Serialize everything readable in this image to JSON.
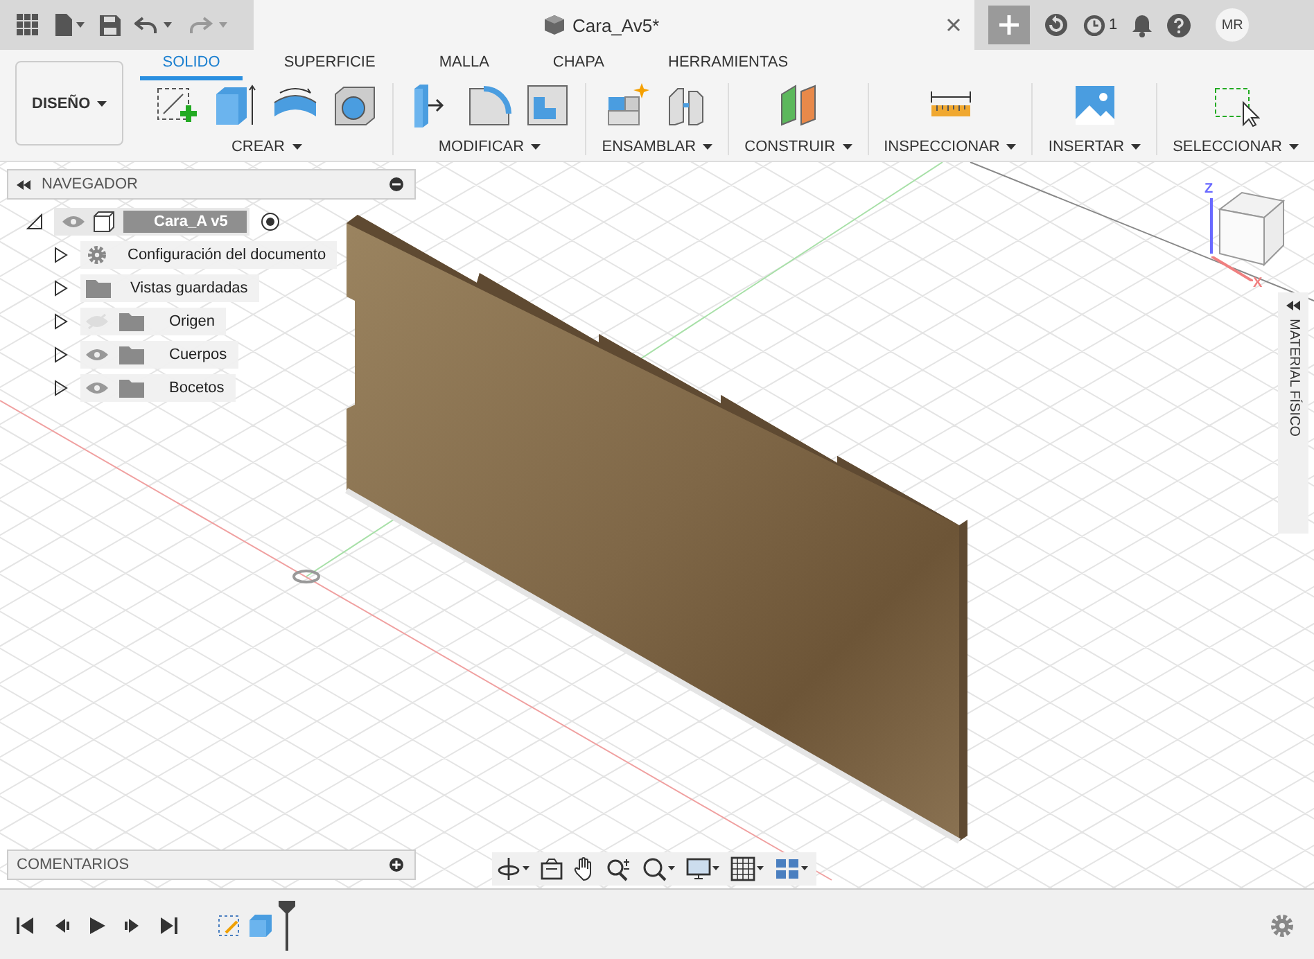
{
  "document_tab": {
    "title": "Cara_Av5*"
  },
  "jobs": {
    "count": "1"
  },
  "user": {
    "initials": "MR"
  },
  "workspace": {
    "label": "DISEÑO"
  },
  "toolbar_tabs": [
    {
      "label": "SOLIDO",
      "selected": true
    },
    {
      "label": "SUPERFICIE",
      "selected": false
    },
    {
      "label": "MALLA",
      "selected": false
    },
    {
      "label": "CHAPA",
      "selected": false
    },
    {
      "label": "HERRAMIENTAS",
      "selected": false
    }
  ],
  "tool_groups": [
    {
      "label": "CREAR",
      "kind": "create"
    },
    {
      "label": "MODIFICAR",
      "kind": "modify"
    },
    {
      "label": "ENSAMBLAR",
      "kind": "assemble"
    },
    {
      "label": "CONSTRUIR",
      "kind": "construct"
    },
    {
      "label": "INSPECCIONAR",
      "kind": "inspect"
    },
    {
      "label": "INSERTAR",
      "kind": "insert"
    },
    {
      "label": "SELECCIONAR",
      "kind": "select"
    }
  ],
  "navigator": {
    "title": "NAVEGADOR",
    "root": {
      "label": "Cara_A v5",
      "expanded": true,
      "children": [
        {
          "label": "Configuración del documento",
          "kind": "settings"
        },
        {
          "label": "Vistas guardadas",
          "kind": "views"
        },
        {
          "label": "Origen",
          "kind": "folder",
          "visible": false
        },
        {
          "label": "Cuerpos",
          "kind": "folder",
          "visible": true
        },
        {
          "label": "Bocetos",
          "kind": "folder",
          "visible": true
        }
      ]
    }
  },
  "view_cube": {
    "axis_z": "Z",
    "axis_x": "X"
  },
  "side_panel": {
    "title": "MATERIAL FÍSICO"
  },
  "comments": {
    "title": "COMENTARIOS"
  }
}
